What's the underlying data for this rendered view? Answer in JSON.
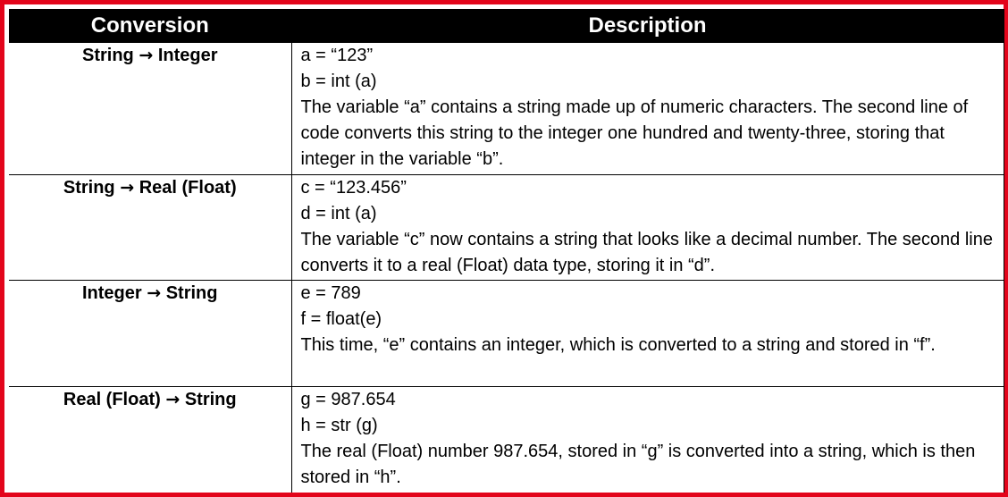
{
  "table": {
    "headers": {
      "conversion": "Conversion",
      "description": "Description"
    },
    "rows": [
      {
        "from": "String",
        "arrow": "→",
        "to": "Integer",
        "code_1": "a = “123”",
        "code_2": "b = int (a)",
        "text": "The variable “a” contains a string made up of numeric characters. The second line of code converts this string to the integer one hundred and twenty-three, storing that integer in the variable “b”."
      },
      {
        "from": "String",
        "arrow": "→",
        "to": "Real (Float)",
        "code_1": "c = “123.456”",
        "code_2": "d = int (a)",
        "text": "The variable “c” now contains a string that looks like a decimal number. The second line converts it to a real (Float) data type, storing it in “d”."
      },
      {
        "from": "Integer",
        "arrow": "→",
        "to": "String",
        "code_1": "e = 789",
        "code_2": "f = float(e)",
        "text": "This time, “e” contains an integer, which is converted to a string and stored in “f”."
      },
      {
        "from": "Real (Float)",
        "arrow": "→",
        "to": "String",
        "code_1": "g = 987.654",
        "code_2": "h = str (g)",
        "text": "The real (Float) number 987.654, stored in “g” is converted into a string, which is then stored in “h”."
      }
    ]
  }
}
